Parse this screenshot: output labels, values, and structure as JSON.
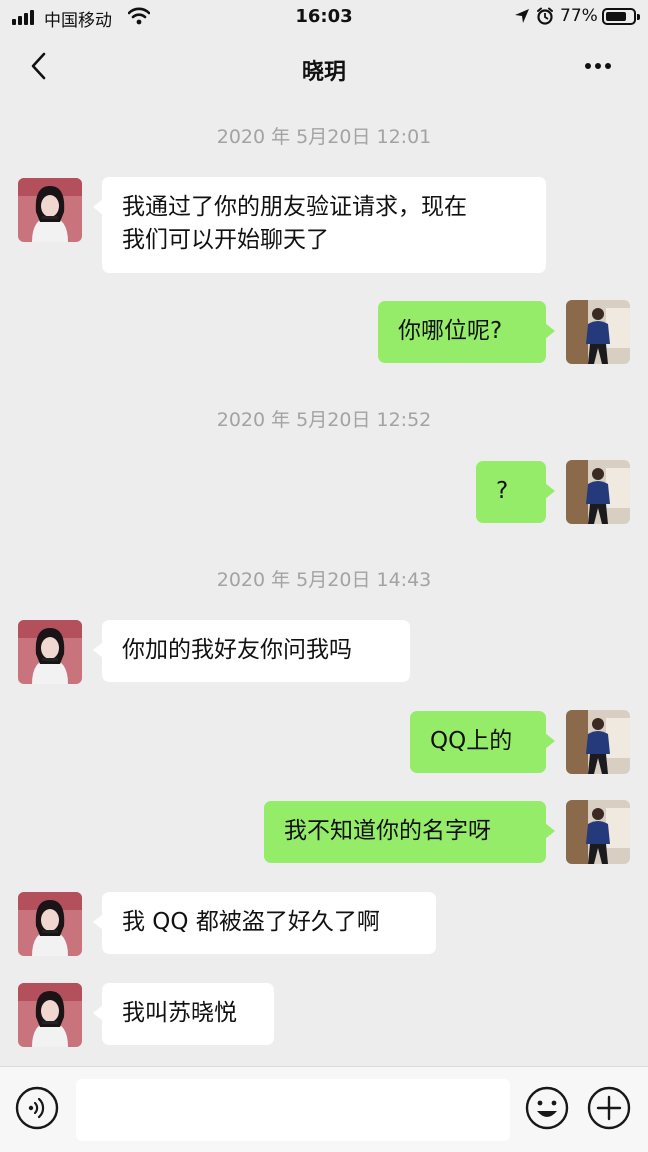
{
  "status_bar": {
    "carrier": "中国移动",
    "time": "16:03",
    "battery_text": "77%",
    "battery_level": 0.77
  },
  "header": {
    "title": "晓玥"
  },
  "timestamps": [
    "2020 年 5月20日 12:01",
    "2020 年 5月20日 12:52",
    "2020 年 5月20日 14:43"
  ],
  "messages": [
    {
      "side": "in",
      "lines": [
        "我通过了你的朋友验证请求，现在",
        "我们可以开始聊天了"
      ]
    },
    {
      "side": "out",
      "lines": [
        "你哪位呢?"
      ]
    },
    {
      "side": "out",
      "lines": [
        "?"
      ]
    },
    {
      "side": "in",
      "lines": [
        "你加的我好友你问我吗"
      ]
    },
    {
      "side": "out",
      "lines": [
        "QQ上的"
      ]
    },
    {
      "side": "out",
      "lines": [
        "我不知道你的名字呀"
      ]
    },
    {
      "side": "in",
      "lines": [
        "我 QQ 都被盗了好久了啊"
      ]
    },
    {
      "side": "in",
      "lines": [
        "我叫苏晓悦"
      ]
    }
  ],
  "input": {
    "value": "",
    "placeholder": ""
  },
  "icons": {
    "back": "chevron-left-icon",
    "more": "more-dots-icon",
    "voice": "voice-icon",
    "emoji": "emoji-icon",
    "plus": "plus-icon"
  },
  "colors": {
    "background": "#ededed",
    "incoming_bubble": "#ffffff",
    "outgoing_bubble": "#95ec69",
    "timestamp": "#a3a3a3"
  }
}
